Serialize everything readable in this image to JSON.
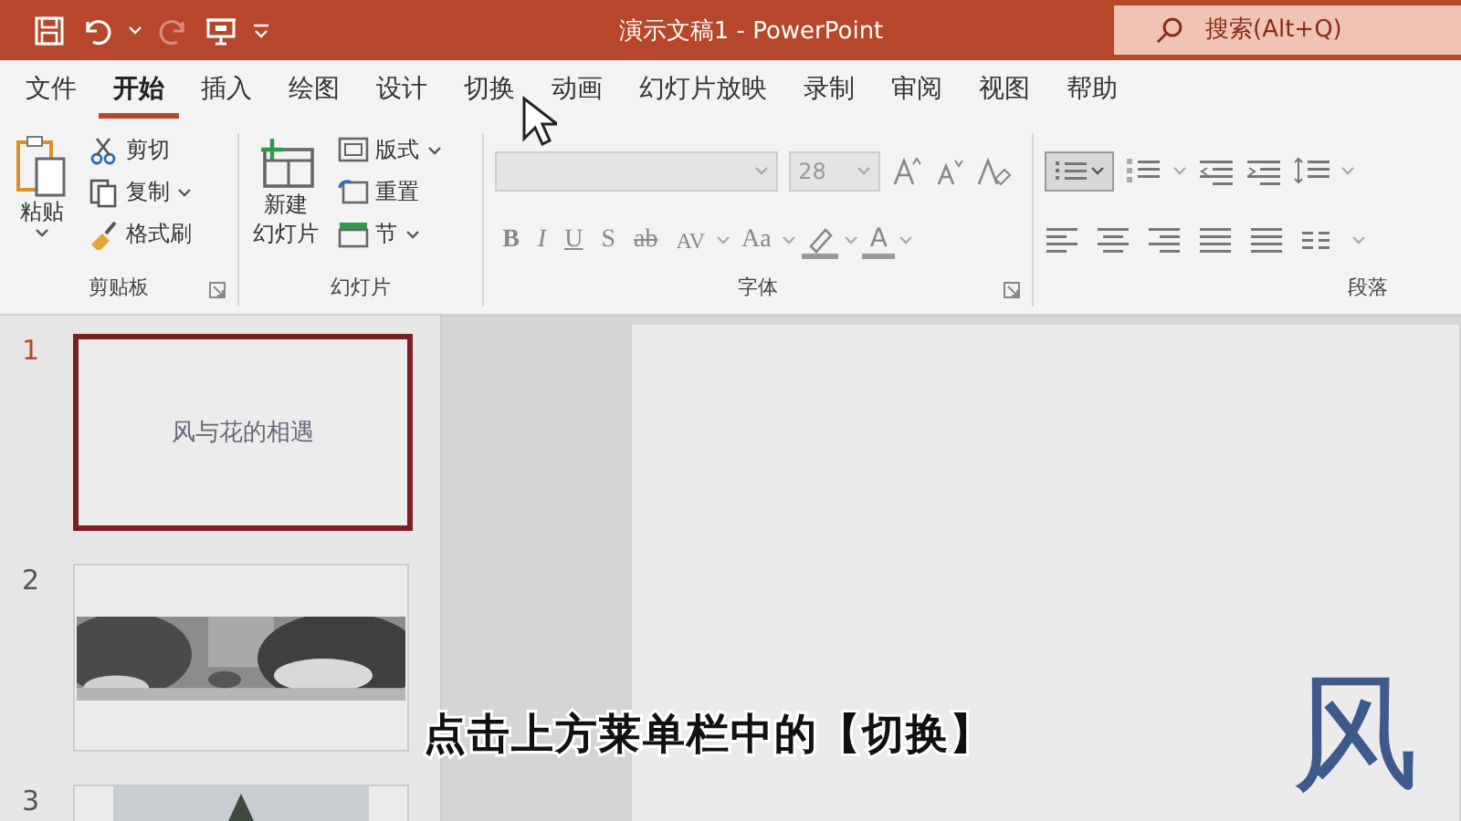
{
  "title_bar": {
    "title": "演示文稿1 - PowerPoint",
    "search": {
      "placeholder": "搜索(Alt+Q)"
    }
  },
  "ribbon_tabs": [
    {
      "label": "文件",
      "selected": false
    },
    {
      "label": "开始",
      "selected": true
    },
    {
      "label": "插入",
      "selected": false
    },
    {
      "label": "绘图",
      "selected": false
    },
    {
      "label": "设计",
      "selected": false
    },
    {
      "label": "切换",
      "selected": false
    },
    {
      "label": "动画",
      "selected": false
    },
    {
      "label": "幻灯片放映",
      "selected": false
    },
    {
      "label": "录制",
      "selected": false
    },
    {
      "label": "审阅",
      "selected": false
    },
    {
      "label": "视图",
      "selected": false
    },
    {
      "label": "帮助",
      "selected": false
    }
  ],
  "clipboard_group": {
    "label": "剪贴板",
    "paste": "粘贴",
    "commands": [
      "剪切",
      "复制",
      "格式刷"
    ]
  },
  "slides_group": {
    "label": "幻灯片",
    "new_slide": "新建",
    "new_slide_2": "幻灯片",
    "commands": [
      "版式",
      "重置",
      "节"
    ]
  },
  "font_group": {
    "label": "字体",
    "font_size": "28",
    "format_buttons": [
      "B",
      "I",
      "U",
      "S",
      "ab"
    ],
    "spacing": "AV",
    "case": "Aa",
    "color_button": "A"
  },
  "paragraph_group": {
    "label": "段落"
  },
  "slide_thumbnails": [
    {
      "number": "1",
      "selected": true,
      "kind": "title",
      "title": "风与花的相遇"
    },
    {
      "number": "2",
      "selected": false,
      "kind": "picture"
    },
    {
      "number": "3",
      "selected": false,
      "kind": "picture"
    }
  ],
  "slide": {
    "title": "风"
  },
  "caption": "点击上方莱单栏中的【切换】"
}
